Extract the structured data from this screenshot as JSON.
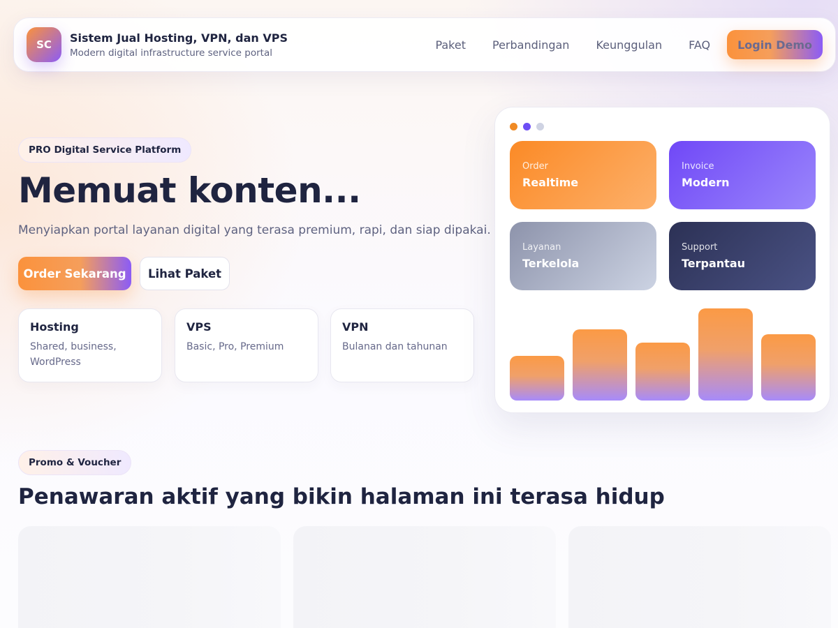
{
  "header": {
    "logo_text": "SC",
    "title": "Sistem Jual Hosting, VPN, dan VPS",
    "subtitle": "Modern digital infrastructure service portal",
    "nav": [
      "Paket",
      "Perbandingan",
      "Keunggulan",
      "FAQ"
    ],
    "login_label": "Login Demo"
  },
  "hero": {
    "badge": "PRO Digital Service Platform",
    "title": "Memuat konten...",
    "subtitle": "Menyiapkan portal layanan digital yang terasa premium, rapi, dan siap dipakai.",
    "primary_cta": "Order Sekarang",
    "secondary_cta": "Lihat Paket",
    "services": [
      {
        "title": "Hosting",
        "desc": "Shared, business, WordPress"
      },
      {
        "title": "VPS",
        "desc": "Basic, Pro, Premium"
      },
      {
        "title": "VPN",
        "desc": "Bulanan dan tahunan"
      }
    ]
  },
  "dashboard": {
    "window_dots": [
      "#f08a24",
      "#6d4ef5",
      "#cfd3e3"
    ],
    "tiles": [
      {
        "label": "Order",
        "value": "Realtime"
      },
      {
        "label": "Invoice",
        "value": "Modern"
      },
      {
        "label": "Layanan",
        "value": "Terkelola"
      },
      {
        "label": "Support",
        "value": "Terpantau"
      }
    ],
    "bar_levels": [
      0.46,
      0.73,
      0.59,
      0.94,
      0.68
    ]
  },
  "promo": {
    "badge": "Promo & Voucher",
    "title": "Penawaran aktif yang bikin halaman ini terasa hidup",
    "cards": 3
  }
}
